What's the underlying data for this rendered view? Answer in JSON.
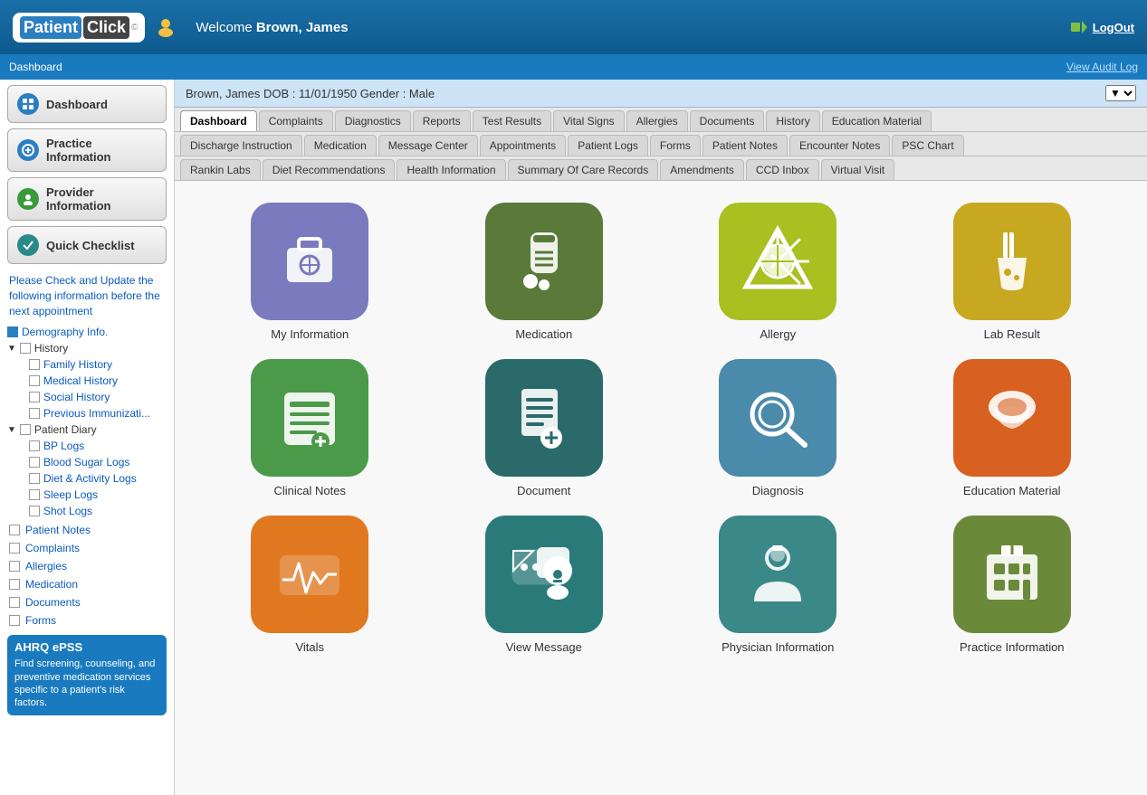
{
  "header": {
    "logo_patient": "Patient",
    "logo_click": "Click",
    "welcome_prefix": "Welcome",
    "user_name": "Brown, James",
    "logout_label": "LogOut",
    "breadcrumb": "Dashboard",
    "audit_log": "View Audit Log"
  },
  "patient_bar": {
    "info": "Brown, James DOB : 11/01/1950 Gender : Male"
  },
  "tabs_row1": [
    {
      "label": "Dashboard",
      "active": true
    },
    {
      "label": "Complaints",
      "active": false
    },
    {
      "label": "Diagnostics",
      "active": false
    },
    {
      "label": "Reports",
      "active": false
    },
    {
      "label": "Test Results",
      "active": false
    },
    {
      "label": "Vital Signs",
      "active": false
    },
    {
      "label": "Allergies",
      "active": false
    },
    {
      "label": "Documents",
      "active": false
    },
    {
      "label": "History",
      "active": false
    },
    {
      "label": "Education Material",
      "active": false
    }
  ],
  "tabs_row2": [
    {
      "label": "Discharge Instruction"
    },
    {
      "label": "Medication"
    },
    {
      "label": "Message Center"
    },
    {
      "label": "Appointments"
    },
    {
      "label": "Patient Logs"
    },
    {
      "label": "Forms"
    },
    {
      "label": "Patient Notes"
    },
    {
      "label": "Encounter Notes"
    },
    {
      "label": "PSC Chart"
    }
  ],
  "tabs_row3": [
    {
      "label": "Rankin Labs"
    },
    {
      "label": "Diet Recommendations"
    },
    {
      "label": "Health Information"
    },
    {
      "label": "Summary Of Care Records"
    },
    {
      "label": "Amendments"
    },
    {
      "label": "CCD Inbox"
    },
    {
      "label": "Virtual Visit"
    }
  ],
  "sidebar": {
    "dashboard_label": "Dashboard",
    "practice_info_label": "Practice Information",
    "provider_info_label": "Provider Information",
    "quick_checklist_label": "Quick Checklist",
    "quick_checklist_text": "Please Check and Update the following information before the next appointment",
    "demography_label": "Demography Info.",
    "history_label": "History",
    "family_history": "Family History",
    "medical_history": "Medical History",
    "social_history": "Social History",
    "prev_immunization": "Previous Immunizati...",
    "patient_diary": "Patient Diary",
    "bp_logs": "BP Logs",
    "blood_sugar_logs": "Blood Sugar Logs",
    "diet_activity_logs": "Diet & Activity Logs",
    "sleep_logs": "Sleep Logs",
    "shot_logs": "Shot Logs",
    "patient_notes": "Patient Notes",
    "complaints": "Complaints",
    "allergies": "Allergies",
    "medication": "Medication",
    "documents": "Documents",
    "forms": "Forms",
    "ahrq_title": "AHRQ ePSS",
    "ahrq_text": "Find screening, counseling, and preventive medication services specific to a patient's risk factors."
  },
  "grid_items": [
    {
      "label": "My  Information",
      "color": "color-purple",
      "icon": "briefcase"
    },
    {
      "label": "Medication",
      "color": "color-olive",
      "icon": "medication"
    },
    {
      "label": "Allergy",
      "color": "color-yellow-green",
      "icon": "allergy"
    },
    {
      "label": "Lab  Result",
      "color": "color-dark-yellow",
      "icon": "lab"
    },
    {
      "label": "Clinical Notes",
      "color": "color-green",
      "icon": "clinical"
    },
    {
      "label": "Document",
      "color": "color-teal-dark",
      "icon": "document"
    },
    {
      "label": "Diagnosis",
      "color": "color-steel-blue",
      "icon": "diagnosis"
    },
    {
      "label": "Education Material",
      "color": "color-orange",
      "icon": "education"
    },
    {
      "label": "Vitals",
      "color": "color-orange2",
      "icon": "vitals"
    },
    {
      "label": "View Message",
      "color": "color-teal2",
      "icon": "message"
    },
    {
      "label": "Physician Information",
      "color": "color-teal3",
      "icon": "physician"
    },
    {
      "label": "Practice Information",
      "color": "color-olive2",
      "icon": "practice"
    }
  ]
}
